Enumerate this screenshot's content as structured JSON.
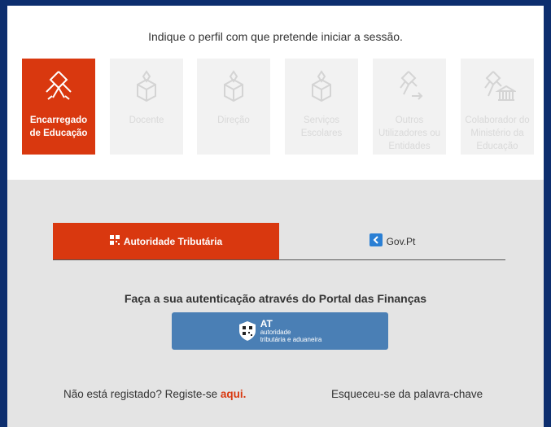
{
  "header": {
    "prompt": "Indique o perfil com que pretende iniciar a sessão."
  },
  "profiles": [
    {
      "label": "Encarregado de Educação",
      "active": true,
      "icon": "encarregado-icon"
    },
    {
      "label": "Docente",
      "active": false,
      "icon": "docente-icon"
    },
    {
      "label": "Direção",
      "active": false,
      "icon": "direcao-icon"
    },
    {
      "label": "Serviços Escolares",
      "active": false,
      "icon": "servicos-icon"
    },
    {
      "label": "Outros Utilizadores ou Entidades",
      "active": false,
      "icon": "outros-icon"
    },
    {
      "label": "Colaborador do Ministério da Educação",
      "active": false,
      "icon": "ministerio-icon"
    }
  ],
  "tabs": {
    "at_label": "Autoridade Tributária",
    "gov_label": "Gov.Pt"
  },
  "auth": {
    "text": "Faça a sua autenticação através do Portal das Finanças",
    "button_big": "AT",
    "button_line1": "autoridade",
    "button_line2": "tributária e aduaneira"
  },
  "footer": {
    "register_text": "Não está registado? Registe-se",
    "register_link": "aqui.",
    "forgot": "Esqueceu-se da palavra-chave"
  },
  "colors": {
    "accent": "#d9380f",
    "border": "#0d2e6e",
    "at_button": "#4a7fb5"
  }
}
